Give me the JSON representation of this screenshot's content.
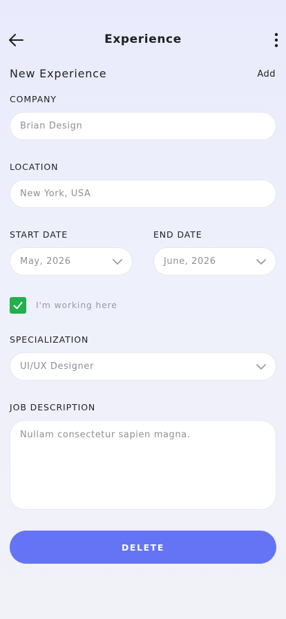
{
  "header": {
    "title": "Experience",
    "back_icon": "arrow-left-icon",
    "more_icon": "more-vertical-icon"
  },
  "form_header": {
    "title": "New Experience",
    "add_label": "Add"
  },
  "fields": {
    "company": {
      "label": "COMPANY",
      "placeholder": "Brian Design"
    },
    "location": {
      "label": "LOCATION",
      "placeholder": "New York, USA"
    },
    "start_date": {
      "label": "START DATE",
      "value": "May, 2026"
    },
    "end_date": {
      "label": "END DATE",
      "value": "June, 2026"
    },
    "working_here": {
      "label": "I'm working here",
      "checked": true
    },
    "specialization": {
      "label": "SPECIALIZATION",
      "value": "UI/UX Designer"
    },
    "job_description": {
      "label": "JOB DESCRIPTION",
      "placeholder": "Nullam consectetur sapien magna."
    }
  },
  "actions": {
    "delete_label": "DELETE"
  },
  "colors": {
    "accent": "#6574f5",
    "checkbox": "#21b04b"
  }
}
